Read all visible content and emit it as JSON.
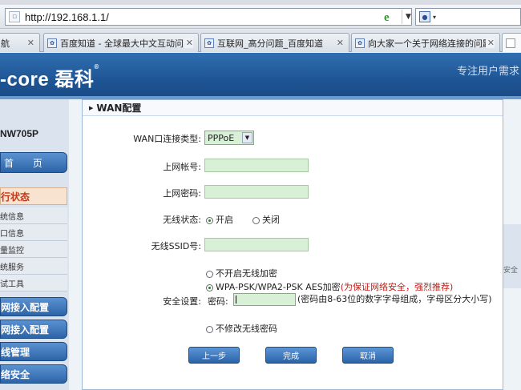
{
  "browser": {
    "url": "http://192.168.1.1/",
    "tabs": [
      {
        "label": "航"
      },
      {
        "label": "百度知道 - 全球最大中文互动问"
      },
      {
        "label": "互联网_高分问题_百度知道"
      },
      {
        "label": "向大家一个关于网络连接的问题!"
      },
      {
        "label": ""
      }
    ]
  },
  "header": {
    "brand": "-core 磊科",
    "slogan": "专注用户需求"
  },
  "sidebar": {
    "model": "NW705P",
    "home": "首 页",
    "section": "行状态",
    "sub_items": [
      "统信息",
      "口信息",
      "量监控",
      "统服务",
      "试工具"
    ],
    "nav": [
      "网接入配置",
      "网接入配置",
      "线管理",
      "络安全"
    ]
  },
  "right_strip": "安全",
  "panel": {
    "title": "WAN配置",
    "wan_type_label": "WAN口连接类型:",
    "wan_type_value": "PPPoE",
    "account_label": "上网帐号:",
    "account_value": "",
    "password_label": "上网密码:",
    "password_value": "",
    "wireless_state_label": "无线状态:",
    "wireless_on": "开启",
    "wireless_off": "关闭",
    "ssid_label": "无线SSID号:",
    "ssid_value": "",
    "security_label": "安全设置:",
    "sec_opt1": "不开启无线加密",
    "sec_opt2": "WPA-PSK/WPA2-PSK AES加密",
    "sec_opt2_note": "(为保证网络安全，强烈推荐)",
    "pwd_label": "密码:",
    "pwd_hint": "(密码由8-63位的数字字母组成，字母区分大小写)",
    "sec_opt3": "不修改无线密码",
    "btn_prev": "上一步",
    "btn_done": "完成",
    "btn_cancel": "取消"
  }
}
